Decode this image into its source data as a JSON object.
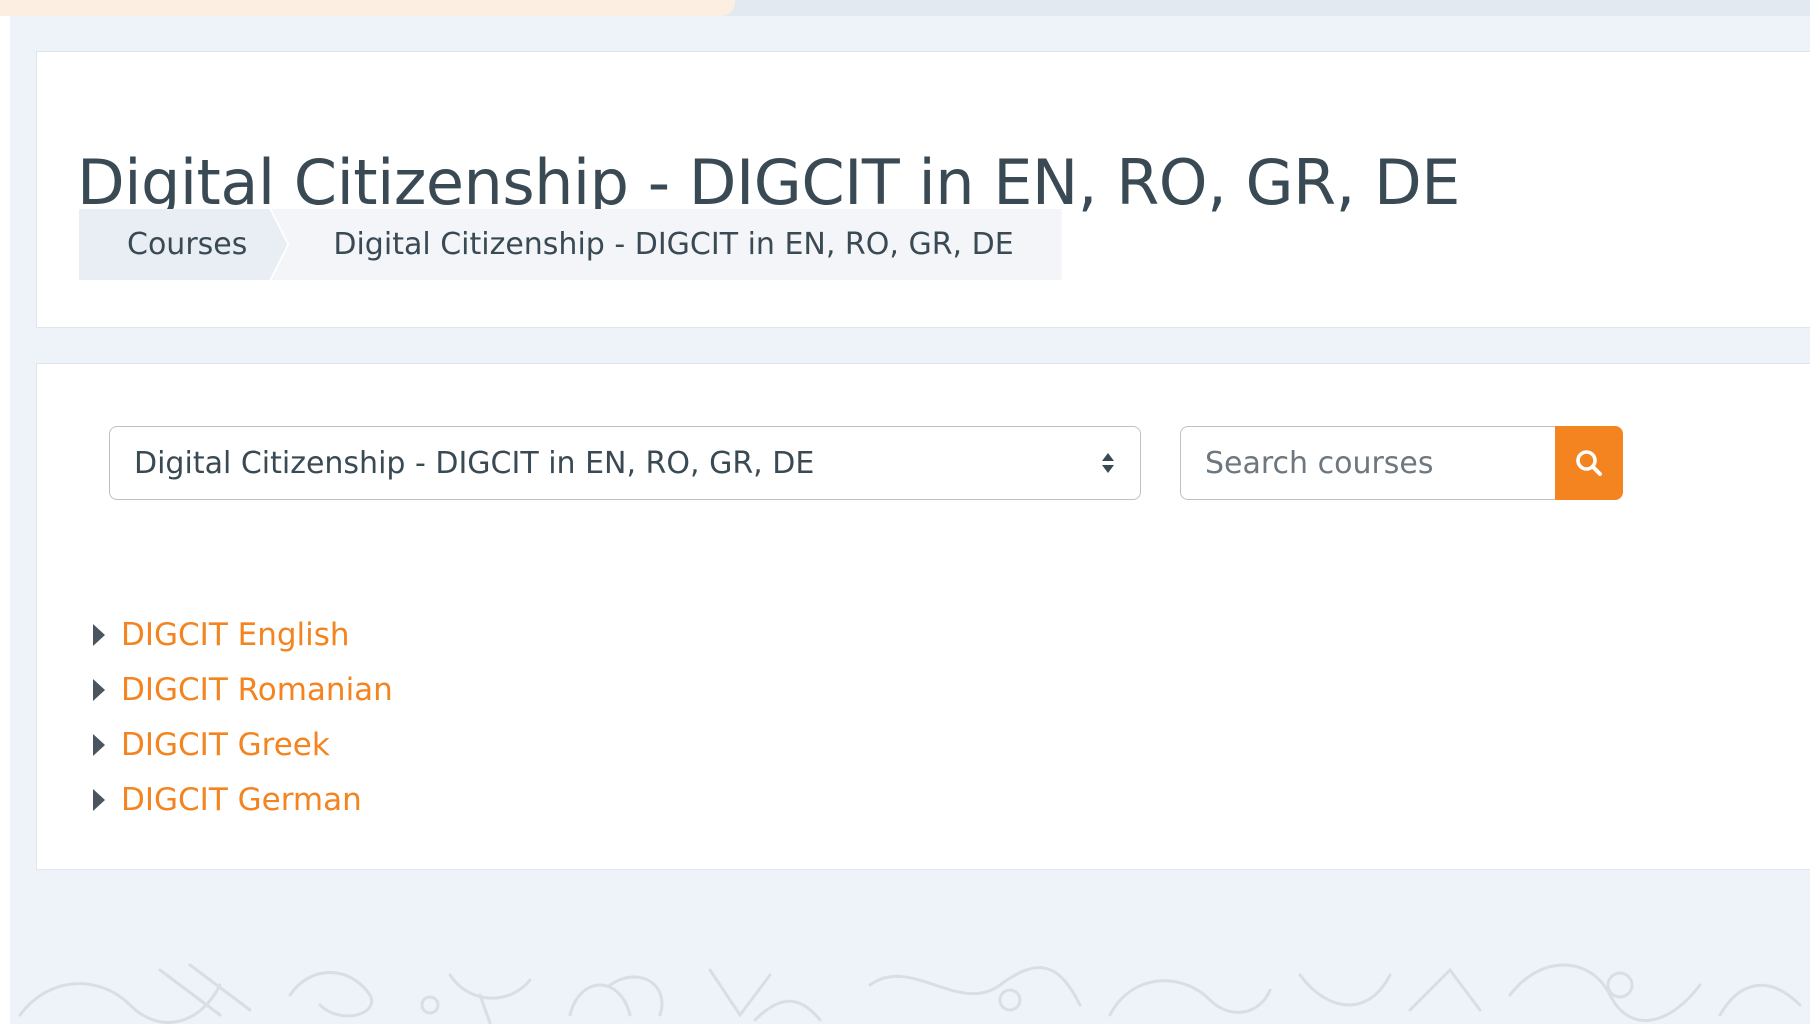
{
  "page": {
    "title": "Digital Citizenship - DIGCIT in EN, RO, GR, DE"
  },
  "breadcrumb": {
    "items": [
      {
        "label": "Courses"
      },
      {
        "label": "Digital Citizenship - DIGCIT in EN, RO, GR, DE"
      }
    ]
  },
  "course_select": {
    "selected": "Digital Citizenship - DIGCIT in EN, RO, GR, DE"
  },
  "search": {
    "placeholder": "Search courses",
    "value": ""
  },
  "categories": [
    {
      "label": "DIGCIT English",
      "collapsed": true
    },
    {
      "label": "DIGCIT Romanian",
      "collapsed": true
    },
    {
      "label": "DIGCIT Greek",
      "collapsed": true
    },
    {
      "label": "DIGCIT German",
      "collapsed": true
    }
  ],
  "colors": {
    "accent": "#f3841f",
    "text": "#3a4a55",
    "background": "#eef3f9",
    "card": "#ffffff"
  },
  "icons": {
    "search_button": "search-icon",
    "select": "sort-arrows-icon",
    "category_toggle": "caret-right-icon"
  }
}
